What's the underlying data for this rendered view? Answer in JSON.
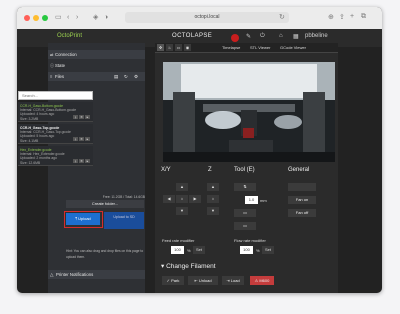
{
  "browser": {
    "url": "octopi.local",
    "colors": {
      "close": "#ff5f57",
      "minimize": "#febc2e",
      "zoom": "#28c840"
    }
  },
  "navbar": {
    "brand": "OctoPrint",
    "center_title": "OCTOLAPSE",
    "user": "pbbeline"
  },
  "sidebar": {
    "connection": "Connection",
    "state": "State",
    "files": "Files",
    "search_placeholder": "Search...",
    "files_list": [
      {
        "name": "CCR-H_Gaso-Bottom.gcode",
        "meta1": "Internal: CCR-H_Gaso-Bottom.gcode",
        "meta2": "Uploaded: 4 hours ago",
        "meta3": "Size: 3.2MB",
        "style": "green"
      },
      {
        "name": "CCR-H_Gaso-Top.gcode",
        "meta1": "Internal: CCR-H_Gaso-Top.gcode",
        "meta2": "Uploaded: 5 hours ago",
        "meta3": "Size: 4.1MB",
        "style": "white"
      },
      {
        "name": "Hex_Extender.gcode",
        "meta1": "Internal: Hex_Extender.gcode",
        "meta2": "Uploaded: 2 months ago",
        "meta3": "Size: 12.6MB",
        "style": "green"
      }
    ],
    "usage": "Free: 11.2GB / Total: 14.6GB",
    "create_folder": "Create folder...",
    "upload": "Upload",
    "upload_sd": "Upload to SD",
    "hint": "Hint: You can also drag and drop files on this page to upload them.",
    "notifications": "Printer Notifications"
  },
  "main": {
    "tabs": [
      "Timelapse",
      "STL Viewer",
      "GCode Viewer"
    ],
    "sections": {
      "xy": "X/Y",
      "z": "Z",
      "tool": "Tool (E)",
      "general": "General"
    },
    "tool_value": "1.0",
    "tool_unit": "mm",
    "fan_on": "Fan on",
    "fan_off": "Fan off",
    "feed_label": "Feed rate modifier",
    "feed_value": "100",
    "flow_label": "Flow rate modifier",
    "flow_value": "100",
    "percent": "%",
    "set": "Set",
    "change_filament": "Change Filament",
    "bottom": {
      "park": "Park",
      "unload": "Unload",
      "load": "Load",
      "mmu": "M600"
    }
  }
}
